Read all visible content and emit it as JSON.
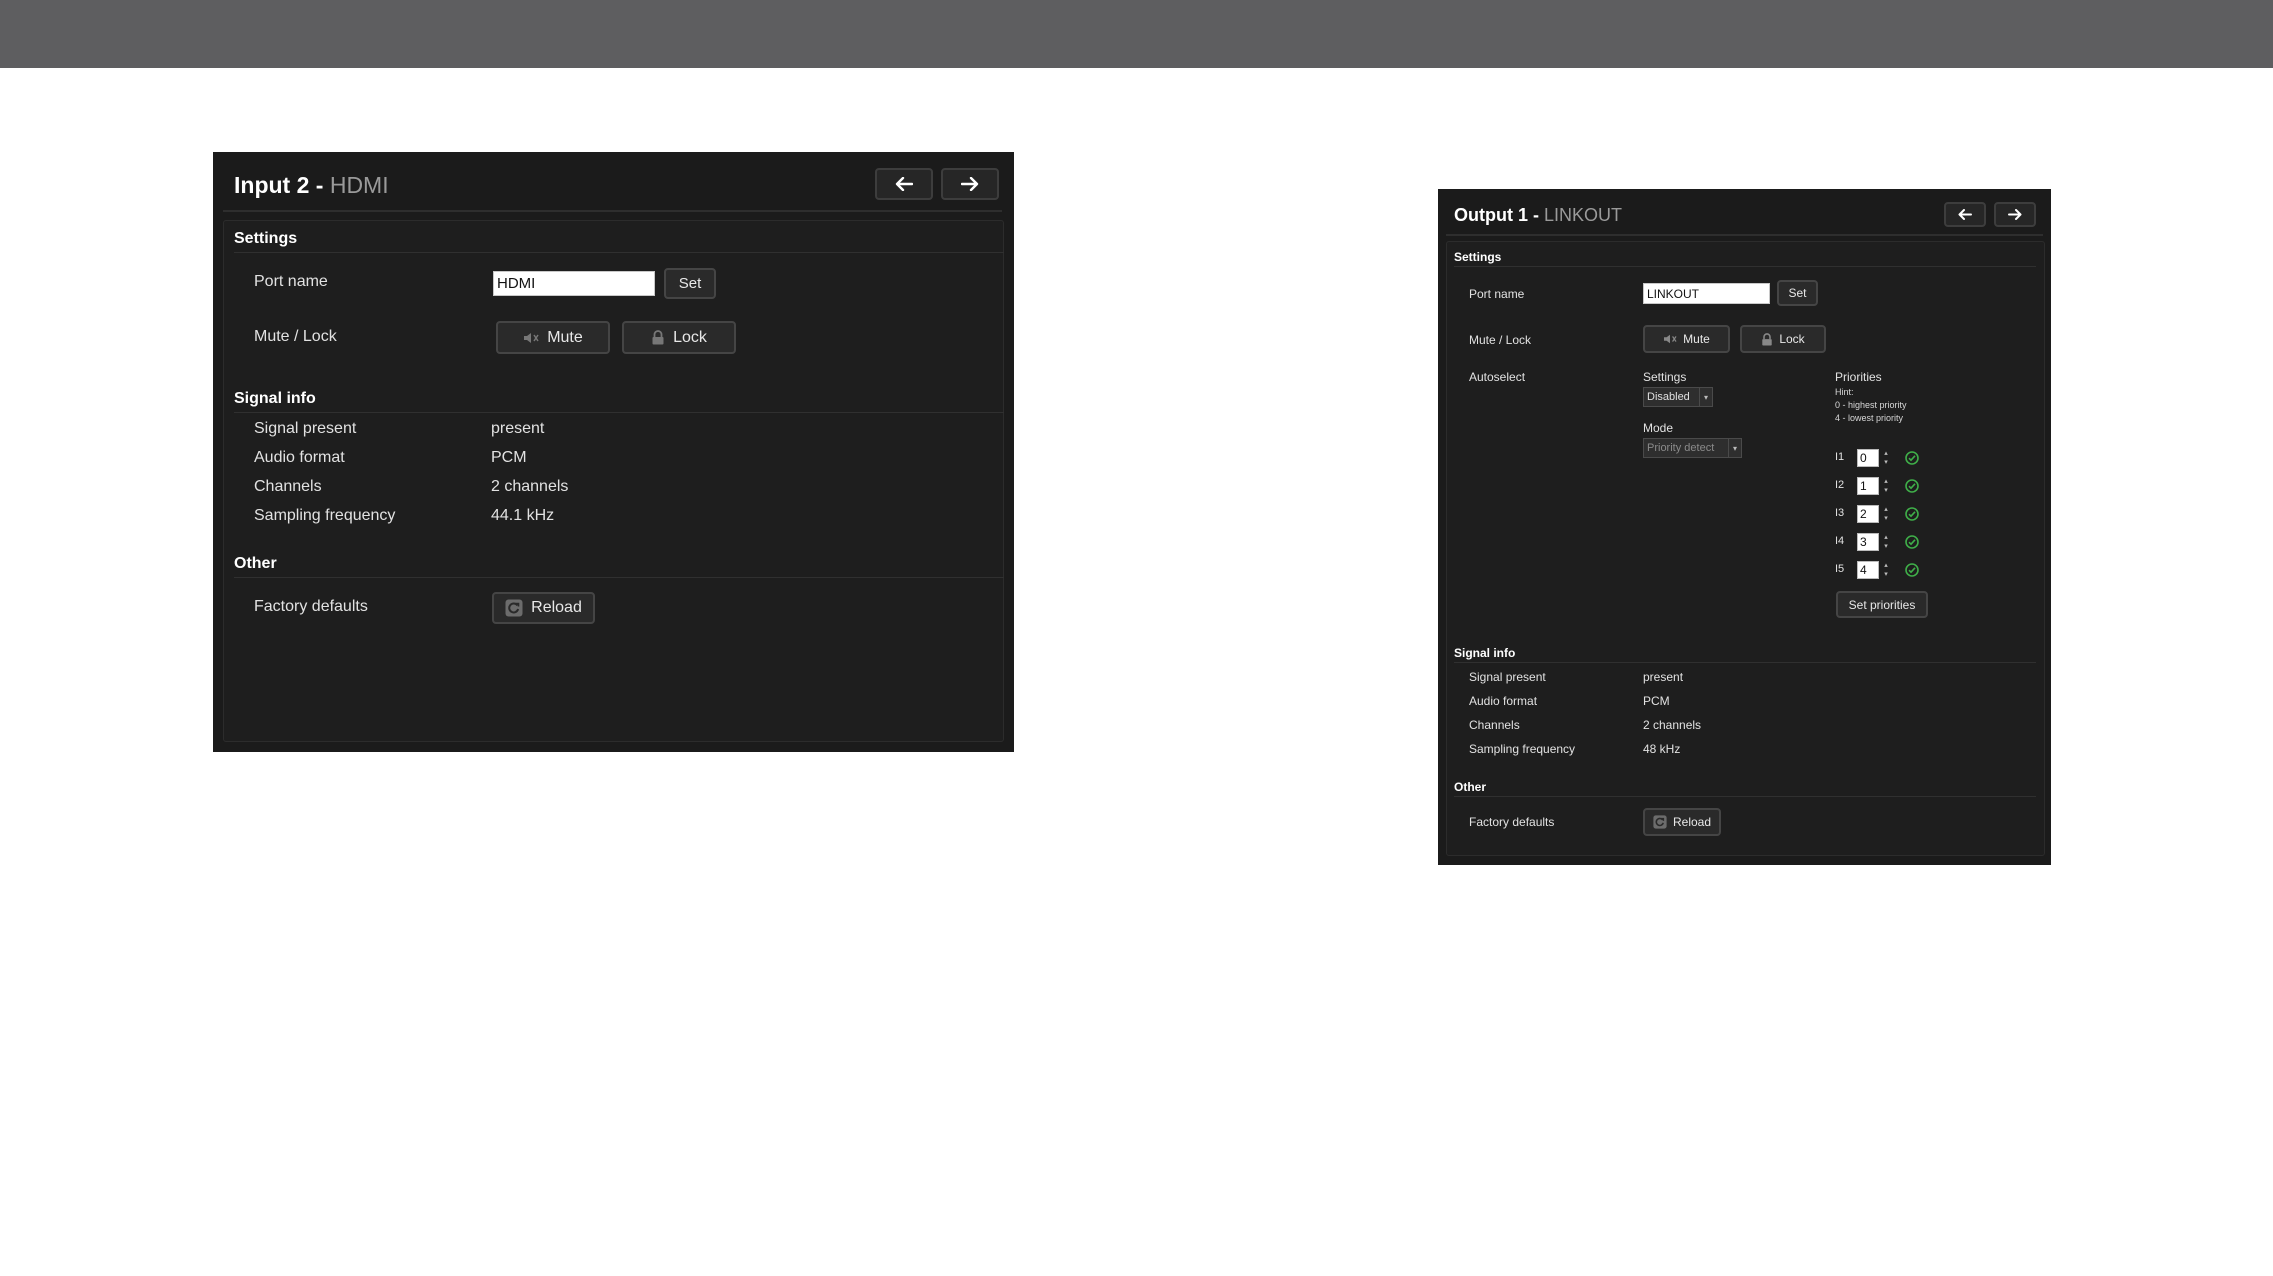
{
  "colors": {
    "topbar": "#5e5e60",
    "panel": "#1b1b1b",
    "check": "#3fae49"
  },
  "input_panel": {
    "title": "Input 2 - ",
    "title_sub": "HDMI",
    "nav_prev_icon": "arrow-left-icon",
    "nav_next_icon": "arrow-right-icon",
    "settings_heading": "Settings",
    "port_name_label": "Port name",
    "port_name_value": "HDMI",
    "set_label": "Set",
    "mute_lock_label": "Mute / Lock",
    "mute_label": "Mute",
    "lock_label": "Lock",
    "signal_heading": "Signal info",
    "signal_rows": [
      {
        "label": "Signal present",
        "value": "present"
      },
      {
        "label": "Audio format",
        "value": "PCM"
      },
      {
        "label": "Channels",
        "value": "2 channels"
      },
      {
        "label": "Sampling frequency",
        "value": "44.1 kHz"
      }
    ],
    "other_heading": "Other",
    "factory_label": "Factory defaults",
    "reload_label": "Reload"
  },
  "output_panel": {
    "title": "Output 1 - ",
    "title_sub": "LINKOUT",
    "settings_heading": "Settings",
    "port_name_label": "Port name",
    "port_name_value": "LINKOUT",
    "set_label": "Set",
    "mute_lock_label": "Mute / Lock",
    "mute_label": "Mute",
    "lock_label": "Lock",
    "autoselect_label": "Autoselect",
    "autoselect_settings_label": "Settings",
    "autoselect_settings_value": "Disabled",
    "mode_label": "Mode",
    "mode_value": "Priority detect",
    "priorities_label": "Priorities",
    "hint_title": "Hint:",
    "hint_line1": "0 - highest priority",
    "hint_line2": "4 - lowest priority",
    "priorities": [
      {
        "input": "I1",
        "value": "0"
      },
      {
        "input": "I2",
        "value": "1"
      },
      {
        "input": "I3",
        "value": "2"
      },
      {
        "input": "I4",
        "value": "3"
      },
      {
        "input": "I5",
        "value": "4"
      }
    ],
    "set_priorities_label": "Set priorities",
    "signal_heading": "Signal info",
    "signal_rows": [
      {
        "label": "Signal present",
        "value": "present"
      },
      {
        "label": "Audio format",
        "value": "PCM"
      },
      {
        "label": "Channels",
        "value": "2 channels"
      },
      {
        "label": "Sampling frequency",
        "value": "48 kHz"
      }
    ],
    "other_heading": "Other",
    "factory_label": "Factory defaults",
    "reload_label": "Reload"
  }
}
